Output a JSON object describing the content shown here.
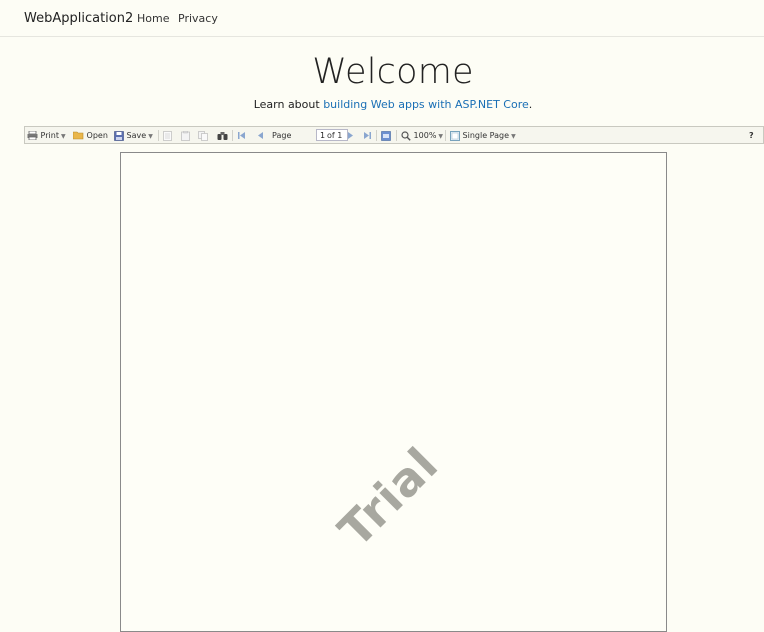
{
  "navbar": {
    "brand": "WebApplication2",
    "links": [
      "Home",
      "Privacy"
    ]
  },
  "hero": {
    "title": "Welcome",
    "text_prefix": "Learn about ",
    "link_text": "building Web apps with ASP.NET Core",
    "text_suffix": "."
  },
  "toolbar": {
    "print": "Print",
    "open": "Open",
    "save": "Save",
    "page_label": "Page",
    "page_value": "1",
    "of_label": "of 1",
    "zoom": "100%",
    "view_mode": "Single Page",
    "help": "?"
  },
  "report": {
    "watermark": "Trial"
  },
  "colors": {
    "background": "#fdfdf5",
    "link": "#1a6fb5",
    "watermark": "#a8a8a0"
  }
}
